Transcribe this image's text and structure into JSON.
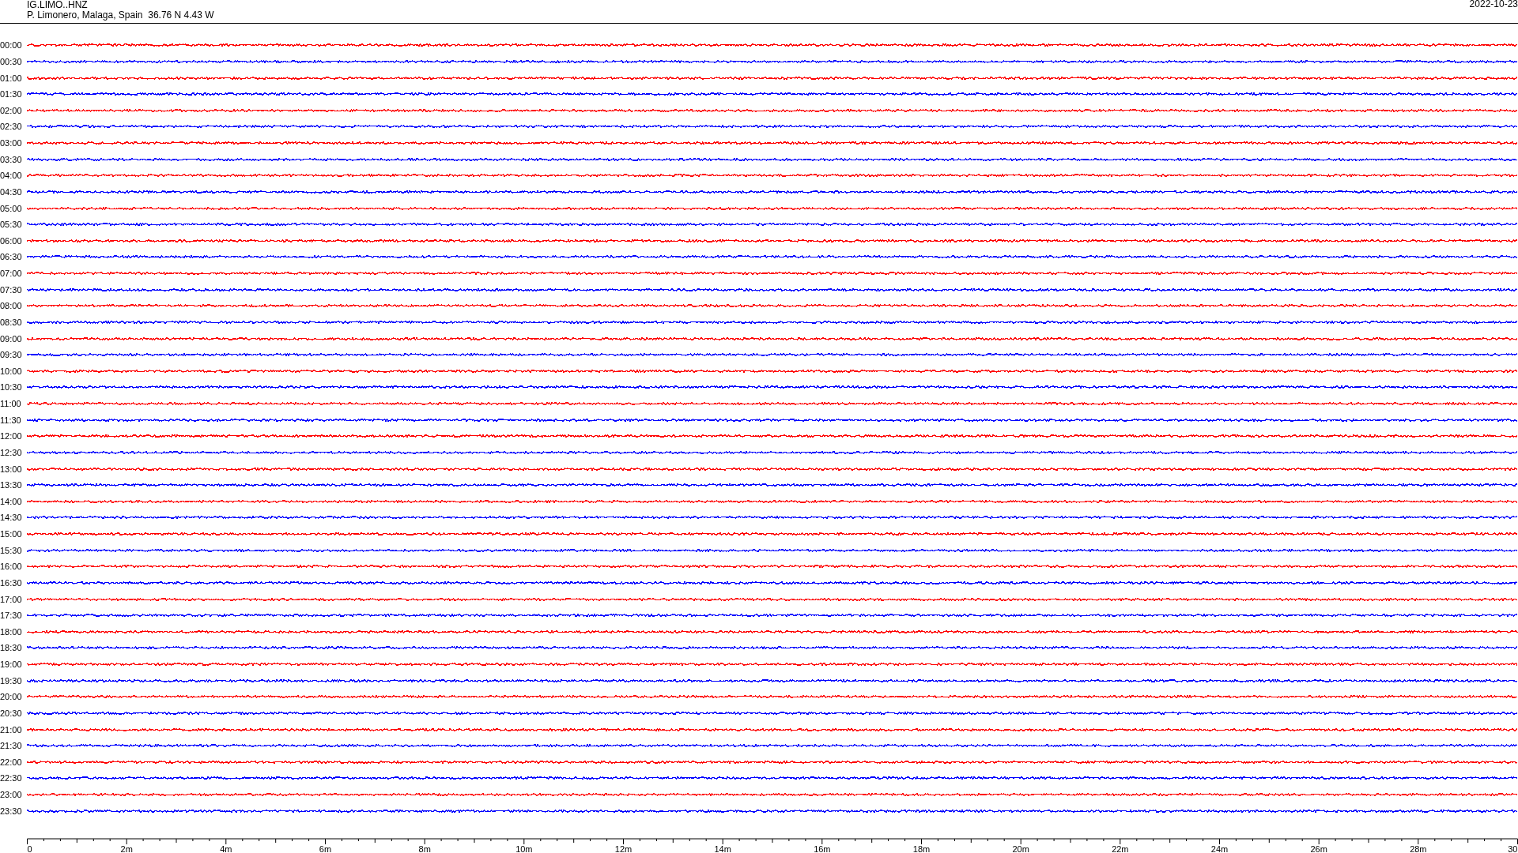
{
  "header": {
    "station": "IG.LIMO..HNZ",
    "location": "P. Limonero, Malaga, Spain  36.76 N 4.43 W",
    "date": "2022-10-23"
  },
  "traces": [
    {
      "time": "00:00",
      "color": "#ff0000"
    },
    {
      "time": "00:30",
      "color": "#0000ff"
    },
    {
      "time": "01:00",
      "color": "#ff0000"
    },
    {
      "time": "01:30",
      "color": "#0000ff"
    },
    {
      "time": "02:00",
      "color": "#ff0000"
    },
    {
      "time": "02:30",
      "color": "#0000ff"
    },
    {
      "time": "03:00",
      "color": "#ff0000"
    },
    {
      "time": "03:30",
      "color": "#0000ff"
    },
    {
      "time": "04:00",
      "color": "#ff0000"
    },
    {
      "time": "04:30",
      "color": "#0000ff"
    },
    {
      "time": "05:00",
      "color": "#ff0000"
    },
    {
      "time": "05:30",
      "color": "#0000ff"
    },
    {
      "time": "06:00",
      "color": "#ff0000"
    },
    {
      "time": "06:30",
      "color": "#0000ff"
    },
    {
      "time": "07:00",
      "color": "#ff0000"
    },
    {
      "time": "07:30",
      "color": "#0000ff"
    },
    {
      "time": "08:00",
      "color": "#ff0000"
    },
    {
      "time": "08:30",
      "color": "#0000ff"
    },
    {
      "time": "09:00",
      "color": "#ff0000"
    },
    {
      "time": "09:30",
      "color": "#0000ff"
    },
    {
      "time": "10:00",
      "color": "#ff0000"
    },
    {
      "time": "10:30",
      "color": "#0000ff"
    },
    {
      "time": "11:00",
      "color": "#ff0000"
    },
    {
      "time": "11:30",
      "color": "#0000ff"
    },
    {
      "time": "12:00",
      "color": "#ff0000"
    },
    {
      "time": "12:30",
      "color": "#0000ff"
    },
    {
      "time": "13:00",
      "color": "#ff0000"
    },
    {
      "time": "13:30",
      "color": "#0000ff"
    },
    {
      "time": "14:00",
      "color": "#ff0000"
    },
    {
      "time": "14:30",
      "color": "#0000ff"
    },
    {
      "time": "15:00",
      "color": "#ff0000"
    },
    {
      "time": "15:30",
      "color": "#0000ff"
    },
    {
      "time": "16:00",
      "color": "#ff0000"
    },
    {
      "time": "16:30",
      "color": "#0000ff"
    },
    {
      "time": "17:00",
      "color": "#ff0000"
    },
    {
      "time": "17:30",
      "color": "#0000ff"
    },
    {
      "time": "18:00",
      "color": "#ff0000"
    },
    {
      "time": "18:30",
      "color": "#0000ff"
    },
    {
      "time": "19:00",
      "color": "#ff0000"
    },
    {
      "time": "19:30",
      "color": "#0000ff"
    },
    {
      "time": "20:00",
      "color": "#ff0000"
    },
    {
      "time": "20:30",
      "color": "#0000ff"
    },
    {
      "time": "21:00",
      "color": "#ff0000"
    },
    {
      "time": "21:30",
      "color": "#0000ff"
    },
    {
      "time": "22:00",
      "color": "#ff0000"
    },
    {
      "time": "22:30",
      "color": "#0000ff"
    },
    {
      "time": "23:00",
      "color": "#ff0000"
    },
    {
      "time": "23:30",
      "color": "#0000ff"
    }
  ],
  "x_axis": {
    "labels": [
      "0",
      "2m",
      "4m",
      "6m",
      "8m",
      "10m",
      "12m",
      "14m",
      "16m",
      "18m",
      "20m",
      "22m",
      "24m",
      "26m",
      "28m",
      "30"
    ]
  }
}
